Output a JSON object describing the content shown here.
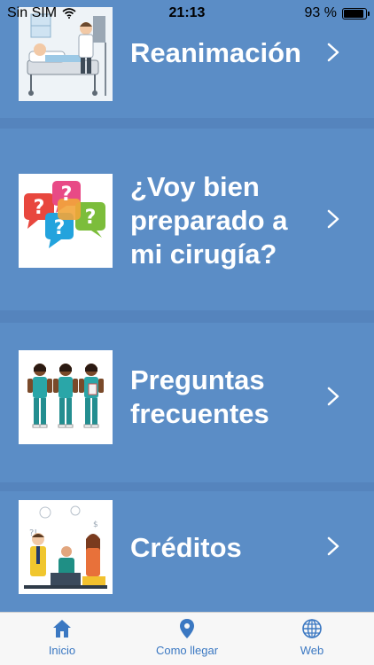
{
  "status": {
    "carrier": "Sin SIM",
    "time": "21:13",
    "battery": "93 %",
    "battery_level": 0.93
  },
  "menu": [
    {
      "label": "Reanimación",
      "image": "recovery-room-illustration"
    },
    {
      "label": "¿Voy bien preparado a mi cirugía?",
      "image": "question-bubbles-illustration"
    },
    {
      "label": "Preguntas frecuentes",
      "image": "nurses-illustration"
    },
    {
      "label": "Créditos",
      "image": "team-illustration"
    }
  ],
  "tabs": [
    {
      "label": "Inicio",
      "icon": "home-icon"
    },
    {
      "label": "Como llegar",
      "icon": "location-pin-icon"
    },
    {
      "label": "Web",
      "icon": "globe-icon"
    }
  ],
  "colors": {
    "background": "#5b8dc6",
    "text": "#ffffff",
    "tab_tint": "#3b78c2"
  }
}
